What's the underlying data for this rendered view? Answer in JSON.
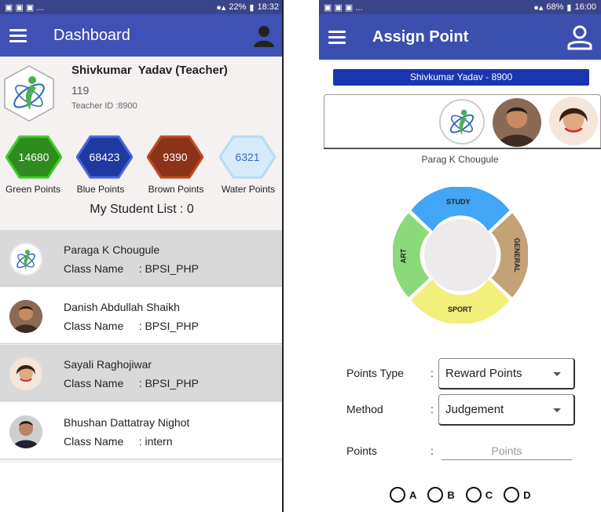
{
  "left": {
    "statusbar": {
      "left_icons": "▣ ▣ ▣ ...",
      "battery": "22%",
      "time": "18:32"
    },
    "toolbar": {
      "title": "Dashboard"
    },
    "profile": {
      "name": "Shivkumar  Yadav (Teacher)",
      "number": "119",
      "teacher_id": "Teacher ID :8900"
    },
    "points": [
      {
        "value": "14680",
        "label": "Green Points",
        "color": "#2e8b1e"
      },
      {
        "value": "68423",
        "label": "Blue Points",
        "color": "#1e3aa0"
      },
      {
        "value": "9390",
        "label": "Brown Points",
        "color": "#8b3318"
      },
      {
        "value": "6321",
        "label": "Water Points",
        "color": "#d6ecfb"
      }
    ],
    "student_list_title": "My Student List  : 0",
    "students": [
      {
        "name": "Paraga K Chougule",
        "class": "Class Name     : BPSI_PHP"
      },
      {
        "name": "Danish Abdullah Shaikh",
        "class": "Class Name     : BPSI_PHP"
      },
      {
        "name": "Sayali Raghojiwar",
        "class": "Class Name     : BPSI_PHP"
      },
      {
        "name": "Bhushan Dattatray Nighot",
        "class": "Class Name     : intern"
      }
    ]
  },
  "right": {
    "statusbar": {
      "left_icons": "▣ ▣ ▣ ...",
      "battery": "68%",
      "time": "16:00"
    },
    "toolbar": {
      "title": "Assign Point"
    },
    "banner": "Shivkumar  Yadav - 8900",
    "selected_student": "Parag K Chougule",
    "wheel": {
      "top": "STUDY",
      "right": "GENERAL",
      "bottom": "SPORT",
      "left": "ART",
      "colors": {
        "study": "#42a5f5",
        "general": "#c2a276",
        "sport": "#f2ef7a",
        "art": "#8bd97a"
      }
    },
    "form": {
      "points_type_label": "Points Type",
      "points_type_value": "Reward Points",
      "method_label": "Method",
      "method_value": "Judgement",
      "points_label": "Points",
      "points_placeholder": "Points",
      "colon": ":"
    },
    "options": [
      "A",
      "B",
      "C",
      "D"
    ]
  }
}
